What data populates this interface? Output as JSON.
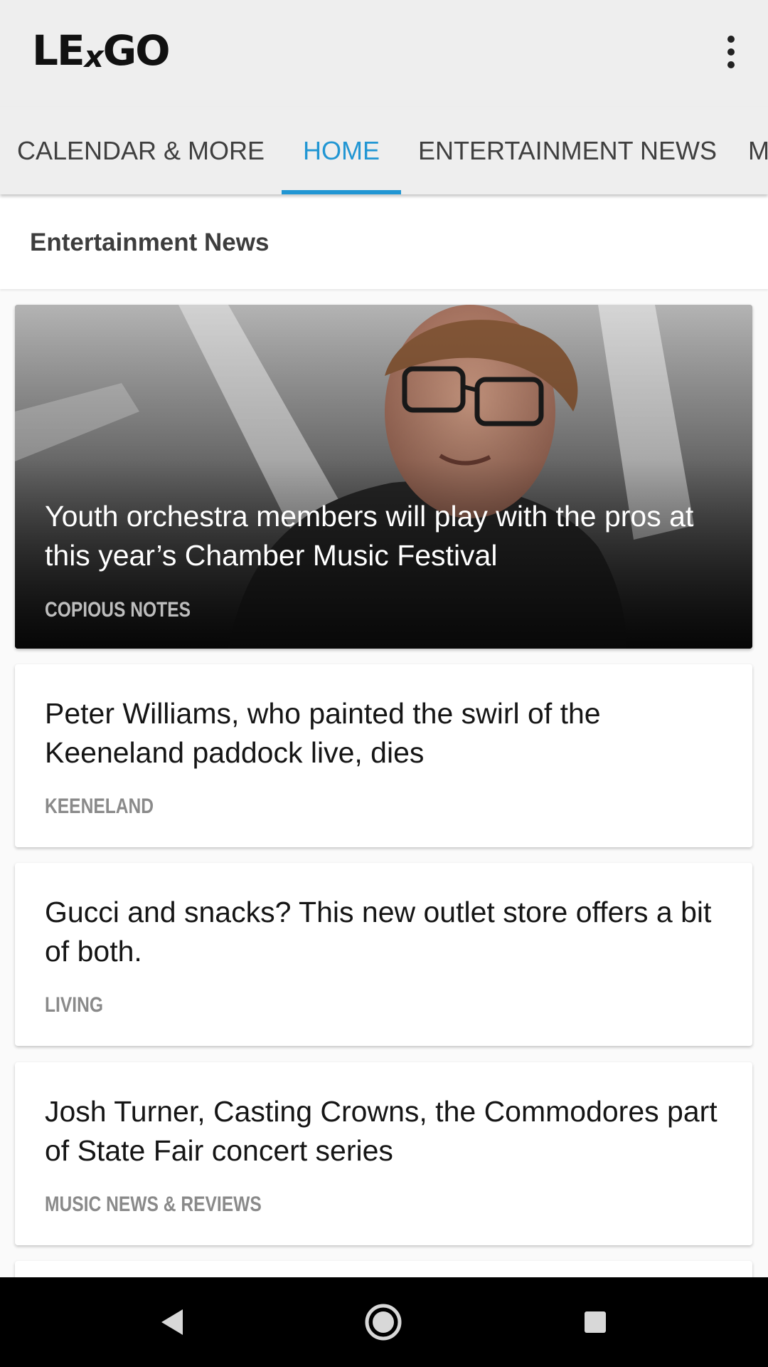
{
  "app": {
    "logo_left": "LE",
    "logo_x": "x",
    "logo_right": "GO"
  },
  "tabs": [
    {
      "label": "CALENDAR & MORE",
      "active": false
    },
    {
      "label": "HOME",
      "active": true
    },
    {
      "label": "ENTERTAINMENT NEWS",
      "active": false
    },
    {
      "label": "M",
      "active": false
    }
  ],
  "section": {
    "title": "Entertainment News"
  },
  "featured": {
    "headline": "Youth orchestra members will play with the pros at this year’s Chamber Music Festival",
    "category": "COPIOUS NOTES"
  },
  "stories": [
    {
      "headline": "Peter Williams, who painted the swirl of the Keeneland paddock live, dies",
      "category": "KEENELAND"
    },
    {
      "headline": "Gucci and snacks? This new outlet store offers a bit of both.",
      "category": "LIVING"
    },
    {
      "headline": "Josh Turner, Casting Crowns, the Commodores part of State Fair concert series",
      "category": "MUSIC NEWS & REVIEWS"
    }
  ],
  "icons": {
    "overflow": "more-vertical-icon",
    "back": "back-triangle-icon",
    "home": "home-circle-icon",
    "recents": "recents-square-icon"
  },
  "colors": {
    "accent": "#2196d3",
    "appbar": "#eeeeee",
    "background": "#fafafa"
  }
}
